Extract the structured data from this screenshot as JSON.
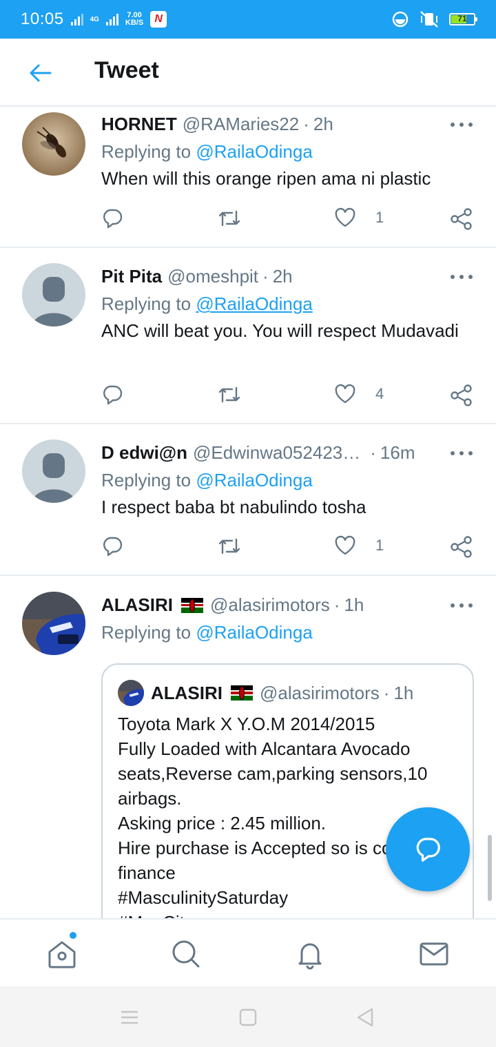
{
  "status_bar": {
    "time": "10:05",
    "network": "4G",
    "speed_value": "7.00",
    "speed_unit": "KB/S",
    "app_badge": "N",
    "battery": "71",
    "battery_level": 0.71
  },
  "header": {
    "title": "Tweet",
    "back_icon": "arrow-left-icon"
  },
  "replying_label": "Replying to",
  "tweets": [
    {
      "name": "HORNET",
      "handle": "@RAMaries22",
      "time": "2h",
      "reply_to": "@RailaOdinga",
      "text": "When will this orange ripen ama  ni plastic",
      "likes": "1"
    },
    {
      "name": "Pit Pita",
      "handle": "@omeshpit",
      "time": "2h",
      "reply_to": "@RailaOdinga",
      "text": "ANC will beat you. You will respect Mudavadi",
      "likes": "4"
    },
    {
      "name": "D edwi@n",
      "handle": "@Edwinwa052423…",
      "time": "16m",
      "reply_to": "@RailaOdinga",
      "text": "I respect baba bt nabulindo tosha",
      "likes": "1"
    },
    {
      "name": "ALASIRI",
      "handle": "@alasirimotors",
      "time": "1h",
      "reply_to": "@RailaOdinga",
      "quote": {
        "name": "ALASIRI",
        "handle": "@alasirimotors",
        "time": "1h",
        "text": "Toyota Mark X Y.O.M 2014/2015\nFully Loaded with Alcantara Avocado seats,Reverse cam,parking sensors,10 airbags.\nAsking price : 2.45 million.\nHire purchase is Accepted so is company finance\n#MasculinitySaturday\n#MenCity"
      }
    }
  ],
  "icons": {
    "reply": "reply-icon",
    "retweet": "retweet-icon",
    "like": "heart-icon",
    "share": "share-icon",
    "more": "more-dots-icon",
    "compose": "compose-reply-icon",
    "home": "home-icon",
    "search": "search-icon",
    "notifications": "bell-icon",
    "messages": "mail-icon"
  },
  "colors": {
    "accent": "#1da1f2",
    "text_primary": "#14171a",
    "text_secondary": "#657786",
    "divider": "#e6ecf0"
  }
}
